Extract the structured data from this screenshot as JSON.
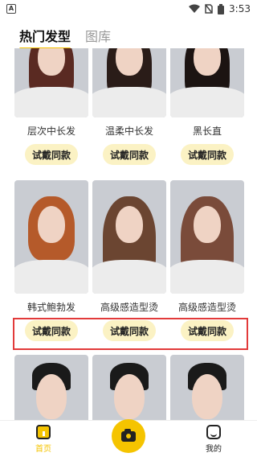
{
  "status": {
    "time": "3:53",
    "left_icon": "a-box-icon"
  },
  "tabs": [
    {
      "label": "热门发型",
      "active": true
    },
    {
      "label": "图库",
      "active": false
    }
  ],
  "try_label": "试戴同款",
  "rows": [
    {
      "items": [
        {
          "name": "层次中长发",
          "hair_color": "#5a2a22"
        },
        {
          "name": "温柔中长发",
          "hair_color": "#2a1c18"
        },
        {
          "name": "黑长直",
          "hair_color": "#1c1412"
        }
      ]
    },
    {
      "items": [
        {
          "name": "韩式鲍勃发",
          "hair_color": "#b55a2a"
        },
        {
          "name": "高级感造型烫",
          "hair_color": "#6b4531"
        },
        {
          "name": "高级感造型烫",
          "hair_color": "#7a4b3a"
        }
      ]
    },
    {
      "items": [
        {
          "name": "",
          "hair_color": "#1a1a1a"
        },
        {
          "name": "",
          "hair_color": "#1a1a1a"
        },
        {
          "name": "",
          "hair_color": "#1a1a1a"
        }
      ]
    }
  ],
  "nav": {
    "home_label": "首页",
    "mine_label": "我的"
  },
  "colors": {
    "accent": "#f5c400",
    "highlight": "#e23a3a"
  }
}
